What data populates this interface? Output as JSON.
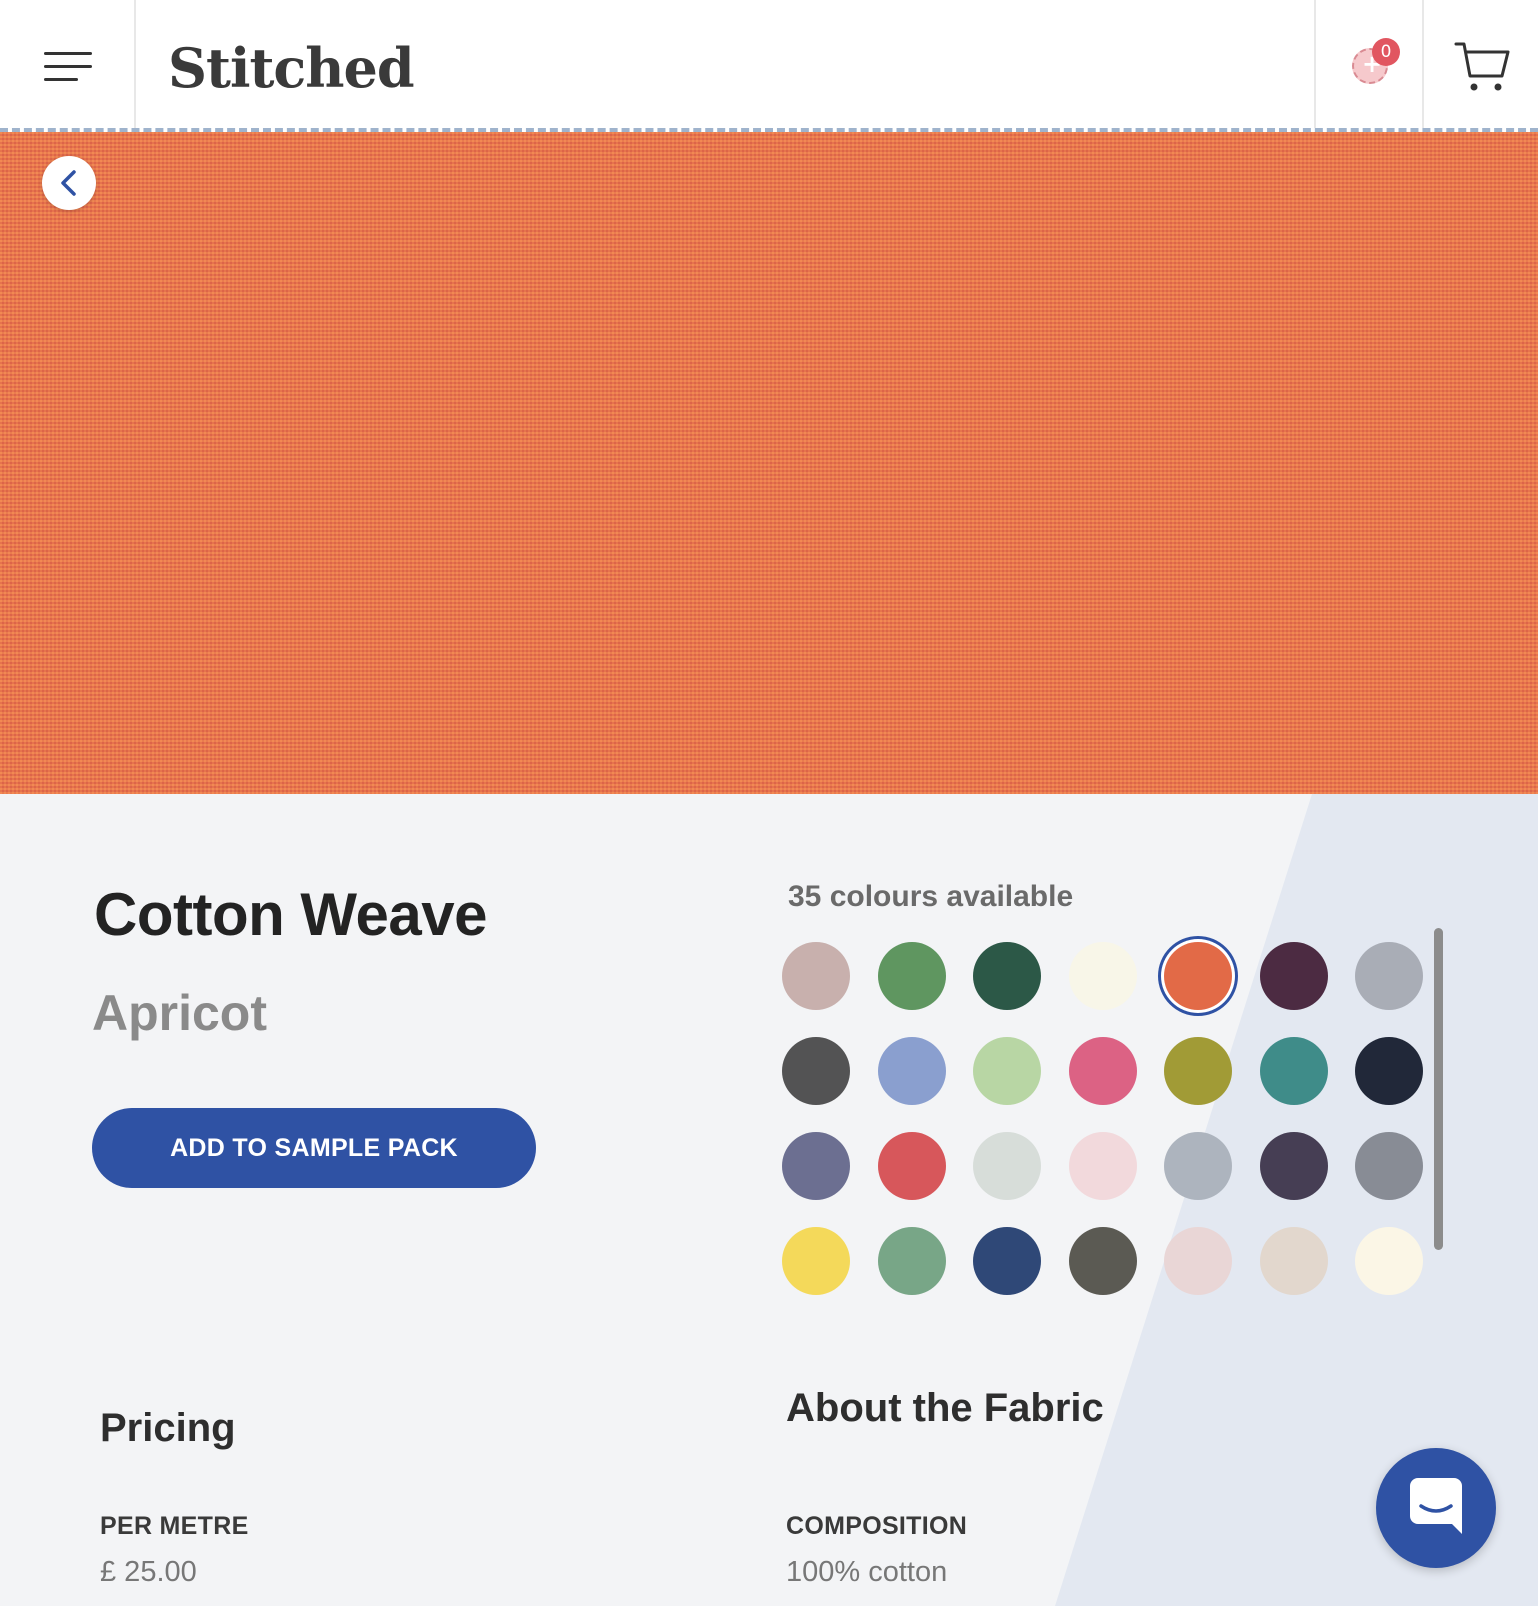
{
  "header": {
    "logo": "Stitched",
    "sample_pack_count": "0"
  },
  "product": {
    "name": "Cotton Weave",
    "colour": "Apricot",
    "add_button_label": "ADD TO SAMPLE PACK"
  },
  "colours": {
    "label": "35 colours available",
    "selected_index": 4,
    "swatches": [
      "#c8b0ad",
      "#5f9660",
      "#2c5847",
      "#f8f6e8",
      "#e26a47",
      "#4c2b42",
      "#a9adb6",
      "#535354",
      "#8a9fcf",
      "#b8d6a4",
      "#dc6284",
      "#a19b36",
      "#3f8c89",
      "#212839",
      "#6c6f91",
      "#d7575b",
      "#d7ddd9",
      "#f2d9dc",
      "#adb4be",
      "#463e54",
      "#888c95",
      "#f4d95a",
      "#78a687",
      "#2f4877",
      "#5b5a53",
      "#e9d6d6",
      "#e2d7cd",
      "#fbf6e6"
    ]
  },
  "pricing": {
    "title": "Pricing",
    "per_metre_label": "PER METRE",
    "per_metre_value": "£ 25.00"
  },
  "about": {
    "title": "About the Fabric",
    "composition_label": "COMPOSITION",
    "composition_value": "100% cotton"
  },
  "colors": {
    "accent": "#2f52a4",
    "hero_fabric": "#e8744e",
    "badge": "#e15660"
  }
}
